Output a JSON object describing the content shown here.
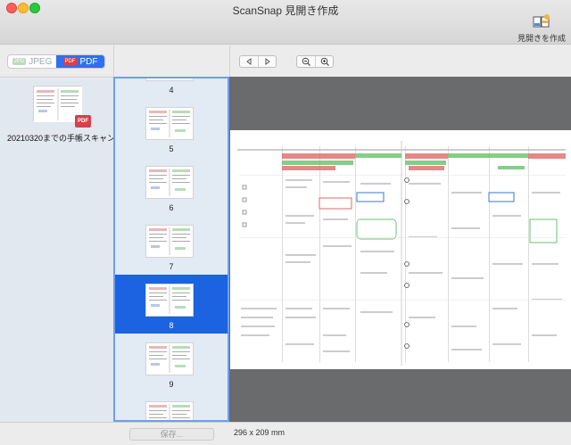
{
  "window": {
    "title": "ScanSnap 見開き作成"
  },
  "toolbar": {
    "create_spread_label": "見開きを作成"
  },
  "format_toggle": {
    "options": [
      {
        "badge": "JPG",
        "label": "JPEG",
        "selected": false
      },
      {
        "badge": "PDF",
        "label": "PDF",
        "selected": true
      }
    ]
  },
  "file": {
    "name": "20210320までの手帳スキャン",
    "badge": "PDF"
  },
  "thumbnails": [
    {
      "page": "4",
      "selected": false
    },
    {
      "page": "5",
      "selected": false
    },
    {
      "page": "6",
      "selected": false
    },
    {
      "page": "7",
      "selected": false
    },
    {
      "page": "8",
      "selected": true
    },
    {
      "page": "9",
      "selected": false
    }
  ],
  "status": {
    "save_label": "保存...",
    "dimensions": "296 x 209 mm"
  },
  "colors": {
    "accent": "#1b63e0",
    "thumb_border": "#6d9ef0",
    "viewer_bg": "#6a6b6d"
  },
  "icons": {
    "nav": [
      "triangle-left-icon",
      "triangle-right-icon"
    ],
    "zoom": [
      "zoom-out-icon",
      "zoom-in-icon"
    ]
  }
}
